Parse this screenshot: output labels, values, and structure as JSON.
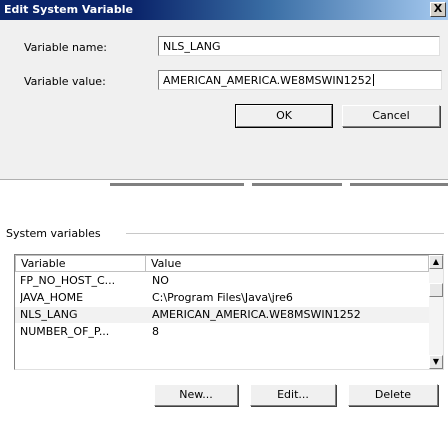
{
  "dialog": {
    "title": "Edit System Variable",
    "close_glyph": "X",
    "variable_name_label": "Variable name:",
    "variable_name_value": "NLS_LANG",
    "variable_value_label": "Variable value:",
    "variable_value_value": "AMERICAN_AMERICA.WE8MSWIN1252",
    "ok_label": "OK",
    "cancel_label": "Cancel"
  },
  "system_variables": {
    "group_label": "System variables",
    "columns": [
      "Variable",
      "Value"
    ],
    "rows": [
      {
        "variable": "FP_NO_HOST_C...",
        "value": "NO"
      },
      {
        "variable": "JAVA_HOME",
        "value": "C:\\Program Files\\Java\\jre6"
      },
      {
        "variable": "NLS_LANG",
        "value": "AMERICAN_AMERICA.WE8MSWIN1252"
      },
      {
        "variable": "NUMBER_OF_P...",
        "value": "8"
      }
    ],
    "selected_row": 2,
    "scroll_up_glyph": "▲",
    "scroll_down_glyph": "▼",
    "new_label": "New...",
    "edit_label": "Edit...",
    "delete_label": "Delete"
  }
}
